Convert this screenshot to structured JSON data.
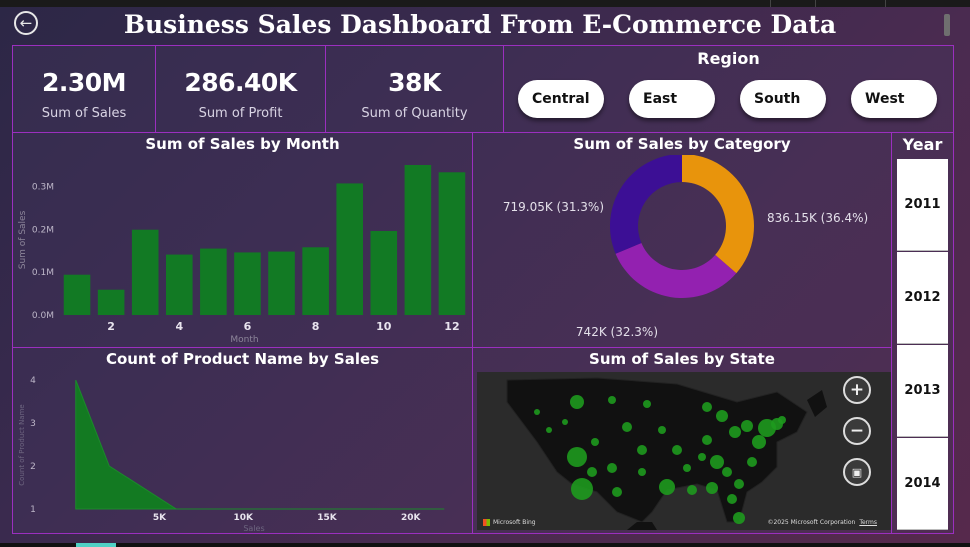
{
  "title": "Business Sales Dashboard From E-Commerce Data",
  "kpis": [
    {
      "value": "2.30M",
      "label": "Sum of Sales"
    },
    {
      "value": "286.40K",
      "label": "Sum of Profit"
    },
    {
      "value": "38K",
      "label": "Sum of Quantity"
    }
  ],
  "region": {
    "title": "Region",
    "options": [
      "Central",
      "East",
      "South",
      "West"
    ]
  },
  "year": {
    "title": "Year",
    "options": [
      "2011",
      "2012",
      "2013",
      "2014"
    ]
  },
  "colors": {
    "bar": "#127a24",
    "area": "#137a22",
    "donut": [
      "#e8940c",
      "#9321b0",
      "#3c0f95"
    ],
    "panel_border": "#9b2fbf",
    "map_dot": "#1e9a1e"
  },
  "map": {
    "title": "Sum of Sales by State",
    "attribution": "Microsoft Bing",
    "copyright": "©2025 Microsoft Corporation",
    "terms": "Terms",
    "controls": [
      "zoom-in",
      "zoom-out",
      "select"
    ]
  },
  "chart_data": [
    {
      "type": "bar",
      "title": "Sum of Sales by Month",
      "xlabel": "Month",
      "ylabel": "Sum of Sales",
      "categories": [
        1,
        2,
        3,
        4,
        5,
        6,
        7,
        8,
        9,
        10,
        11,
        12
      ],
      "x_tick_labels": [
        "2",
        "4",
        "6",
        "8",
        "10",
        "12"
      ],
      "values": [
        0.094,
        0.059,
        0.199,
        0.141,
        0.155,
        0.146,
        0.148,
        0.158,
        0.307,
        0.196,
        0.35,
        0.333
      ],
      "unit": "M",
      "ylim": [
        0,
        0.35
      ],
      "y_ticks": [
        "0.0M",
        "0.1M",
        "0.2M",
        "0.3M"
      ],
      "grid": false
    },
    {
      "type": "pie",
      "title": "Sum of Sales by Category",
      "donut": true,
      "values": [
        836.15,
        742,
        719.05
      ],
      "labels": [
        "836.15K (36.4%)",
        "742K (32.3%)",
        "719.05K (31.3%)"
      ],
      "percentages": [
        36.4,
        32.3,
        31.3
      ]
    },
    {
      "type": "area",
      "title": "Count of Product Name by Sales",
      "xlabel": "Sales",
      "ylabel": "Count of Product Name",
      "x": [
        0,
        2000,
        6000,
        8000,
        22000
      ],
      "y": [
        4,
        2,
        1,
        1,
        1
      ],
      "xlim": [
        -1000,
        23000
      ],
      "ylim": [
        1,
        4
      ],
      "x_ticks": [
        "5K",
        "10K",
        "15K",
        "20K"
      ],
      "y_ticks": [
        "1",
        "2",
        "3",
        "4"
      ]
    }
  ]
}
